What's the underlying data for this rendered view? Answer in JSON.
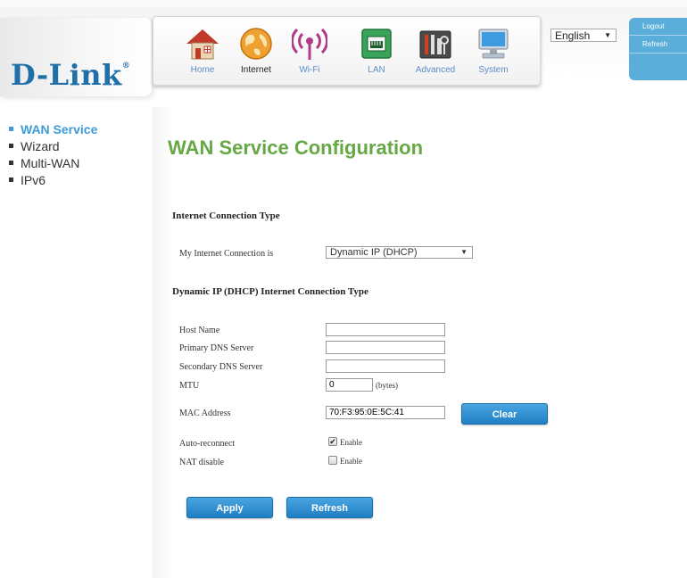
{
  "brand": {
    "logo": "D-Link"
  },
  "nav": {
    "items": [
      {
        "label": "Home",
        "icon": "home-icon"
      },
      {
        "label": "Internet",
        "icon": "globe-icon",
        "active": true
      },
      {
        "label": "Wi-Fi",
        "icon": "wifi-icon"
      },
      {
        "label": "LAN",
        "icon": "lan-icon"
      },
      {
        "label": "Advanced",
        "icon": "tools-icon"
      },
      {
        "label": "System",
        "icon": "computer-icon"
      }
    ]
  },
  "language": {
    "selected": "English"
  },
  "account": {
    "logout": "Logout",
    "refresh": "Refresh"
  },
  "sidebar": {
    "items": [
      {
        "label": "WAN Service",
        "active": true
      },
      {
        "label": "Wizard"
      },
      {
        "label": "Multi-WAN"
      },
      {
        "label": "IPv6"
      }
    ]
  },
  "page": {
    "title": "WAN Service Configuration",
    "connection_type_heading": "Internet Connection Type",
    "my_connection_label": "My Internet Connection is",
    "my_connection_value": "Dynamic IP (DHCP)",
    "dhcp_heading": "Dynamic IP (DHCP) Internet Connection Type",
    "host_name_label": "Host Name",
    "host_name_value": "",
    "primary_dns_label": "Primary DNS Server",
    "primary_dns_value": "",
    "secondary_dns_label": "Secondary DNS Server",
    "secondary_dns_value": "",
    "mtu_label": "MTU",
    "mtu_value": "0",
    "mtu_unit": "(bytes)",
    "mac_label": "MAC Address",
    "mac_value": "70:F3:95:0E:5C:41",
    "clear_button": "Clear",
    "auto_reconnect_label": "Auto-reconnect",
    "auto_reconnect_checked": true,
    "auto_reconnect_option": "Enable",
    "nat_disable_label": "NAT disable",
    "nat_disable_checked": false,
    "nat_disable_option": "Enable",
    "apply_button": "Apply",
    "refresh_button": "Refresh"
  },
  "colors": {
    "accent_blue": "#3c9cd6",
    "title_green": "#66a844",
    "button_blue": "#2a8ad0"
  }
}
